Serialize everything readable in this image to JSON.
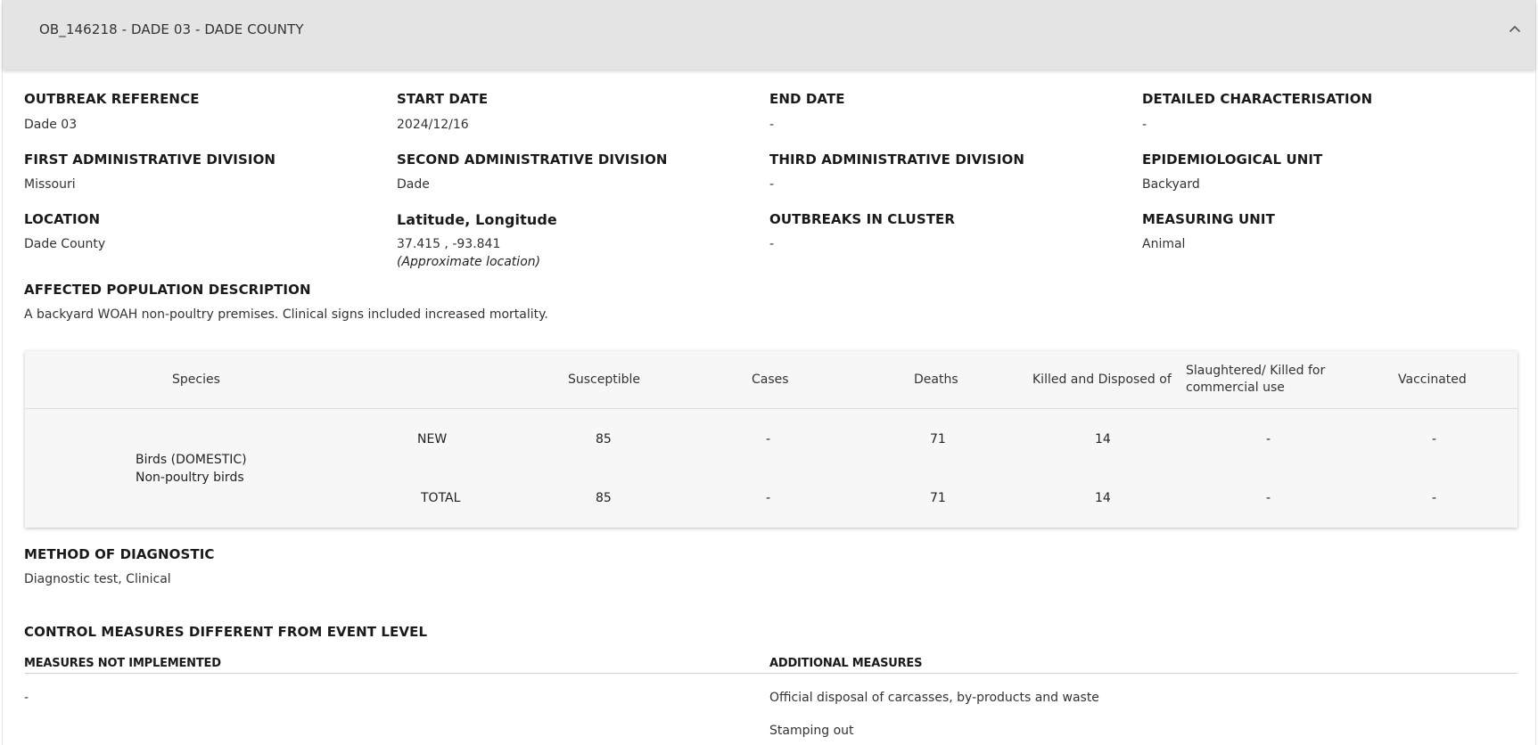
{
  "header": {
    "title": "OB_146218 - DADE 03 - DADE COUNTY",
    "chevron_icon": "chevron-up-icon"
  },
  "fields": {
    "outbreak_reference": {
      "label": "OUTBREAK REFERENCE",
      "value": "Dade 03"
    },
    "start_date": {
      "label": "START DATE",
      "value": "2024/12/16"
    },
    "end_date": {
      "label": "END DATE",
      "value": "-"
    },
    "detailed_characterisation": {
      "label": "DETAILED CHARACTERISATION",
      "value": "-"
    },
    "first_admin_division": {
      "label": "FIRST ADMINISTRATIVE DIVISION",
      "value": "Missouri"
    },
    "second_admin_division": {
      "label": "SECOND ADMINISTRATIVE DIVISION",
      "value": "Dade"
    },
    "third_admin_division": {
      "label": "THIRD ADMINISTRATIVE DIVISION",
      "value": "-"
    },
    "epidemiological_unit": {
      "label": "EPIDEMIOLOGICAL UNIT",
      "value": "Backyard"
    },
    "location": {
      "label": "LOCATION",
      "value": "Dade County"
    },
    "lat_long": {
      "label": "Latitude, Longitude",
      "value": "37.415 , -93.841",
      "note": "(Approximate location)"
    },
    "outbreaks_in_cluster": {
      "label": "OUTBREAKS IN CLUSTER",
      "value": "-"
    },
    "measuring_unit": {
      "label": "MEASURING UNIT",
      "value": "Animal"
    },
    "affected_population": {
      "label": "AFFECTED POPULATION DESCRIPTION",
      "value": "A backyard WOAH non-poultry premises. Clinical signs included increased mortality."
    }
  },
  "table": {
    "headers": {
      "species": "Species",
      "susceptible": "Susceptible",
      "cases": "Cases",
      "deaths": "Deaths",
      "killed_disposed": "Killed and Disposed of",
      "slaughtered": "Slaughtered/ Killed for commercial use",
      "vaccinated": "Vaccinated"
    },
    "species_line1": "Birds (DOMESTIC)",
    "species_line2": "Non-poultry birds",
    "rows": [
      {
        "type": "NEW",
        "susceptible": "85",
        "cases": "-",
        "deaths": "71",
        "killed_disposed": "14",
        "slaughtered": "-",
        "vaccinated": "-"
      },
      {
        "type": "TOTAL",
        "susceptible": "85",
        "cases": "-",
        "deaths": "71",
        "killed_disposed": "14",
        "slaughtered": "-",
        "vaccinated": "-"
      }
    ]
  },
  "diagnostic": {
    "label": "METHOD OF DIAGNOSTIC",
    "value": "Diagnostic test, Clinical"
  },
  "control_measures": {
    "title": "CONTROL MEASURES DIFFERENT FROM EVENT LEVEL",
    "not_implemented": {
      "label": "MEASURES NOT IMPLEMENTED",
      "items": [
        "-"
      ]
    },
    "additional": {
      "label": "ADDITIONAL MEASURES",
      "items": [
        "Official disposal of carcasses, by-products and waste",
        "Stamping out"
      ]
    }
  }
}
